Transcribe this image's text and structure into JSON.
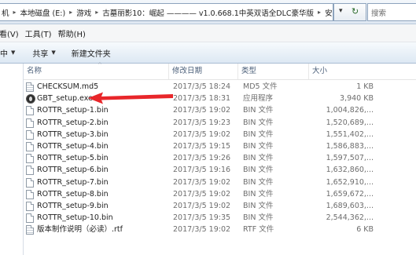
{
  "address": {
    "crumbs": [
      "机",
      "本地磁盘 (E:)",
      "游戏",
      "古墓丽影10：崛起 ———— v1.0.668.1中英双语全DLC豪华版",
      "安装"
    ]
  },
  "menu": [
    "看(V)",
    "工具(T)",
    "帮助(H)"
  ],
  "toolbar": {
    "share": "共享",
    "new_folder": "新建文件夹",
    "left_fragment": "中"
  },
  "columns": {
    "name": "名称",
    "date": "修改日期",
    "type": "类型",
    "size": "大小"
  },
  "files": [
    {
      "name": "CHECKSUM.md5",
      "date": "2017/3/5 18:24",
      "type": "MD5 文件",
      "size": "1 KB",
      "icon": "md5-file-icon"
    },
    {
      "name": "GBT_setup.exe",
      "date": "2017/3/5 18:31",
      "type": "应用程序",
      "size": "3,940 KB",
      "icon": "exe-icon"
    },
    {
      "name": "ROTTR_setup-1.bin",
      "date": "2017/3/5 19:02",
      "type": "BIN 文件",
      "size": "1,004,826,...",
      "icon": "bin-file-icon"
    },
    {
      "name": "ROTTR_setup-2.bin",
      "date": "2017/3/5 19:23",
      "type": "BIN 文件",
      "size": "1,520,689,...",
      "icon": "bin-file-icon"
    },
    {
      "name": "ROTTR_setup-3.bin",
      "date": "2017/3/5 19:02",
      "type": "BIN 文件",
      "size": "1,551,402,...",
      "icon": "bin-file-icon"
    },
    {
      "name": "ROTTR_setup-4.bin",
      "date": "2017/3/5 19:15",
      "type": "BIN 文件",
      "size": "1,586,883,...",
      "icon": "bin-file-icon"
    },
    {
      "name": "ROTTR_setup-5.bin",
      "date": "2017/3/5 19:26",
      "type": "BIN 文件",
      "size": "1,597,507,...",
      "icon": "bin-file-icon"
    },
    {
      "name": "ROTTR_setup-6.bin",
      "date": "2017/3/5 19:16",
      "type": "BIN 文件",
      "size": "1,632,860,...",
      "icon": "bin-file-icon"
    },
    {
      "name": "ROTTR_setup-7.bin",
      "date": "2017/3/5 19:02",
      "type": "BIN 文件",
      "size": "1,652,910,...",
      "icon": "bin-file-icon"
    },
    {
      "name": "ROTTR_setup-8.bin",
      "date": "2017/3/5 19:02",
      "type": "BIN 文件",
      "size": "1,659,672,...",
      "icon": "bin-file-icon"
    },
    {
      "name": "ROTTR_setup-9.bin",
      "date": "2017/3/5 19:02",
      "type": "BIN 文件",
      "size": "1,689,603,...",
      "icon": "bin-file-icon"
    },
    {
      "name": "ROTTR_setup-10.bin",
      "date": "2017/3/5 19:35",
      "type": "BIN 文件",
      "size": "2,544,362,...",
      "icon": "bin-file-icon"
    },
    {
      "name": "版本制作说明（必读）.rtf",
      "date": "2017/3/5 19:02",
      "type": "RTF 文件",
      "size": "6 KB",
      "icon": "rtf-file-icon"
    }
  ],
  "colors": {
    "annotation_arrow": "#e8262a",
    "header_text": "#4c607a",
    "meta_text": "#6d6d6d"
  }
}
